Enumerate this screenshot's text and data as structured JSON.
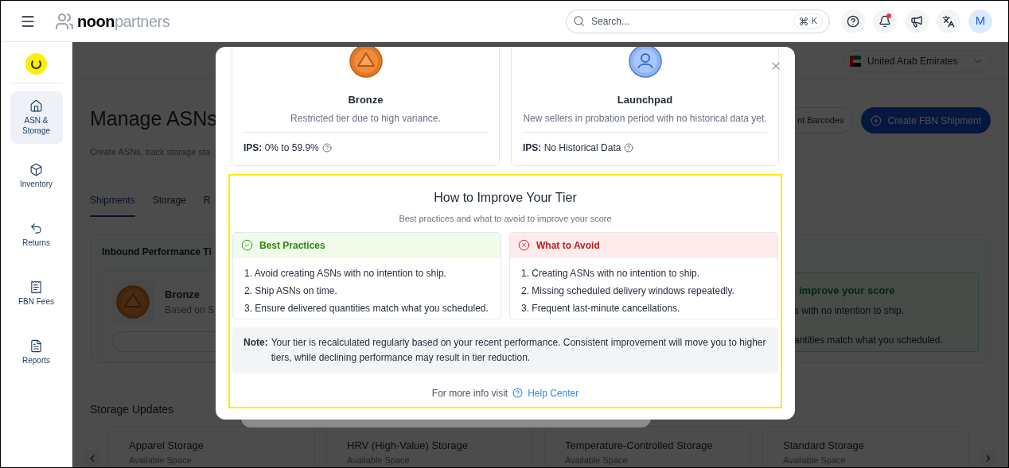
{
  "header": {
    "brand_bold": "noon",
    "brand_light": "partners",
    "search": {
      "placeholder": "Search...",
      "shortcut": "K"
    },
    "notifications_unread": true,
    "avatar": "M"
  },
  "sidebar": {
    "items": [
      {
        "label": "ASN & Storage",
        "kind": "home",
        "selected": true
      },
      {
        "label": "Inventory",
        "kind": "box",
        "selected": false
      },
      {
        "label": "Returns",
        "kind": "return",
        "selected": false
      },
      {
        "label": "FBN Fees",
        "kind": "receipt",
        "selected": false
      },
      {
        "label": "Reports",
        "kind": "report",
        "selected": false
      }
    ]
  },
  "page": {
    "country": "United Arab Emirates",
    "title": "Manage ASNs",
    "subtitle": "Create ASNs, track storage sta",
    "tabs": [
      {
        "label": "Shipments",
        "selected": true
      },
      {
        "label": "Storage",
        "selected": false
      },
      {
        "label": "R",
        "selected": false
      }
    ],
    "buttons": [
      {
        "label": "nt Barcodes",
        "kind": "outline"
      },
      {
        "label": "Create FBN Shipment",
        "kind": "primary"
      }
    ],
    "performance_card": {
      "title": "Inbound Performance Ti",
      "tier": "Bronze",
      "tier_note": "Based on S"
    },
    "tips_card": {
      "title": "improve your score",
      "lines": [
        "s with no intention to ship.",
        "antities match what you scheduled."
      ]
    },
    "storage": {
      "title": "Storage Updates",
      "cards": [
        {
          "name": "Apparel Storage",
          "caption": "Available Space"
        },
        {
          "name": "HRV (High-Value) Storage",
          "caption": "Available Space"
        },
        {
          "name": "Temperature-Controlled Storage",
          "caption": "Available Space"
        },
        {
          "name": "Standard Storage",
          "caption": "Available Space"
        }
      ]
    }
  },
  "modal": {
    "tiers": [
      {
        "name": "Bronze",
        "kind": "bronze",
        "description": "Restricted tier due to high variance.",
        "ips_label": "IPS:",
        "ips_value": "0% to 59.9%"
      },
      {
        "name": "Launchpad",
        "kind": "launchpad",
        "description": "New sellers in probation period with no historical data yet.",
        "ips_label": "IPS:",
        "ips_value": "No Historical Data"
      }
    ],
    "improve": {
      "title": "How to Improve Your Tier",
      "subtitle": "Best practices and what to avoid to improve your score",
      "panels": [
        {
          "kind": "good",
          "title": "Best Practices",
          "items": [
            "1. Avoid creating ASNs with no intention to ship.",
            "2. Ship ASNs on time.",
            "3. Ensure delivered quantities match what you scheduled."
          ]
        },
        {
          "kind": "bad",
          "title": "What to Avoid",
          "items": [
            "1. Creating ASNs with no intention to ship.",
            "2. Missing scheduled delivery windows repeatedly.",
            "3. Frequent last-minute cancellations."
          ]
        }
      ],
      "note": {
        "label": "Note:",
        "text": "Your tier is recalculated regularly based on your recent performance. Consistent improvement will move you to higher tiers, while declining performance may result in tier reduction."
      },
      "footer": {
        "text": "For more info visit",
        "link": "Help Center"
      }
    }
  }
}
